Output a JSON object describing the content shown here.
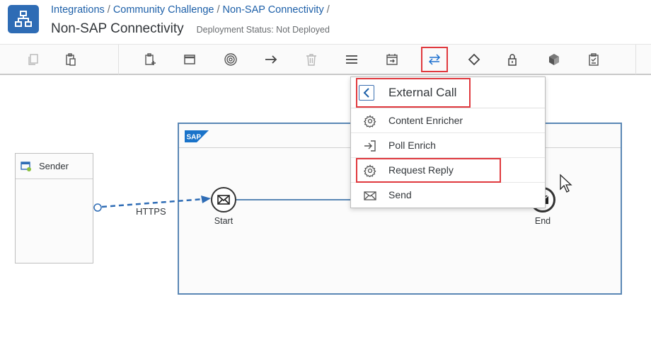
{
  "header": {
    "breadcrumb": [
      "Integrations",
      "Community Challenge",
      "Non-SAP Connectivity"
    ],
    "separator": "/",
    "title": "Non-SAP Connectivity",
    "deployment_status": "Deployment Status: Not Deployed"
  },
  "toolbar": {
    "buttons": [
      {
        "icon": "copy-icon",
        "enabled": false
      },
      {
        "icon": "paste-icon",
        "enabled": true
      },
      {
        "icon": "participants-icon",
        "enabled": true
      },
      {
        "icon": "process-icon",
        "enabled": true
      },
      {
        "icon": "events-icon",
        "enabled": true
      },
      {
        "icon": "connector-arrow-icon",
        "enabled": true
      },
      {
        "icon": "delete-icon",
        "enabled": false
      },
      {
        "icon": "menu-lines-icon",
        "enabled": true
      },
      {
        "icon": "call-icon",
        "enabled": true
      },
      {
        "icon": "external-call-icon",
        "enabled": true,
        "active": true
      },
      {
        "icon": "gateway-icon",
        "enabled": true
      },
      {
        "icon": "security-lock-icon",
        "enabled": true
      },
      {
        "icon": "persistence-cube-icon",
        "enabled": true
      },
      {
        "icon": "validator-icon",
        "enabled": true
      }
    ]
  },
  "menu": {
    "title": "External Call",
    "items": [
      {
        "label": "Content Enricher",
        "icon": "gear-icon"
      },
      {
        "label": "Poll Enrich",
        "icon": "sign-in-icon"
      },
      {
        "label": "Request Reply",
        "icon": "gear-icon"
      },
      {
        "label": "Send",
        "icon": "envelope-icon"
      }
    ]
  },
  "canvas": {
    "sender_label": "Sender",
    "connection_label": "HTTPS",
    "start_label": "Start",
    "end_label": "End",
    "pool_logo": "SAP"
  },
  "colors": {
    "brand": "#2e6cb5",
    "link": "#1c5fa8",
    "highlight": "#e0393e",
    "flow": "#5a87b5"
  }
}
